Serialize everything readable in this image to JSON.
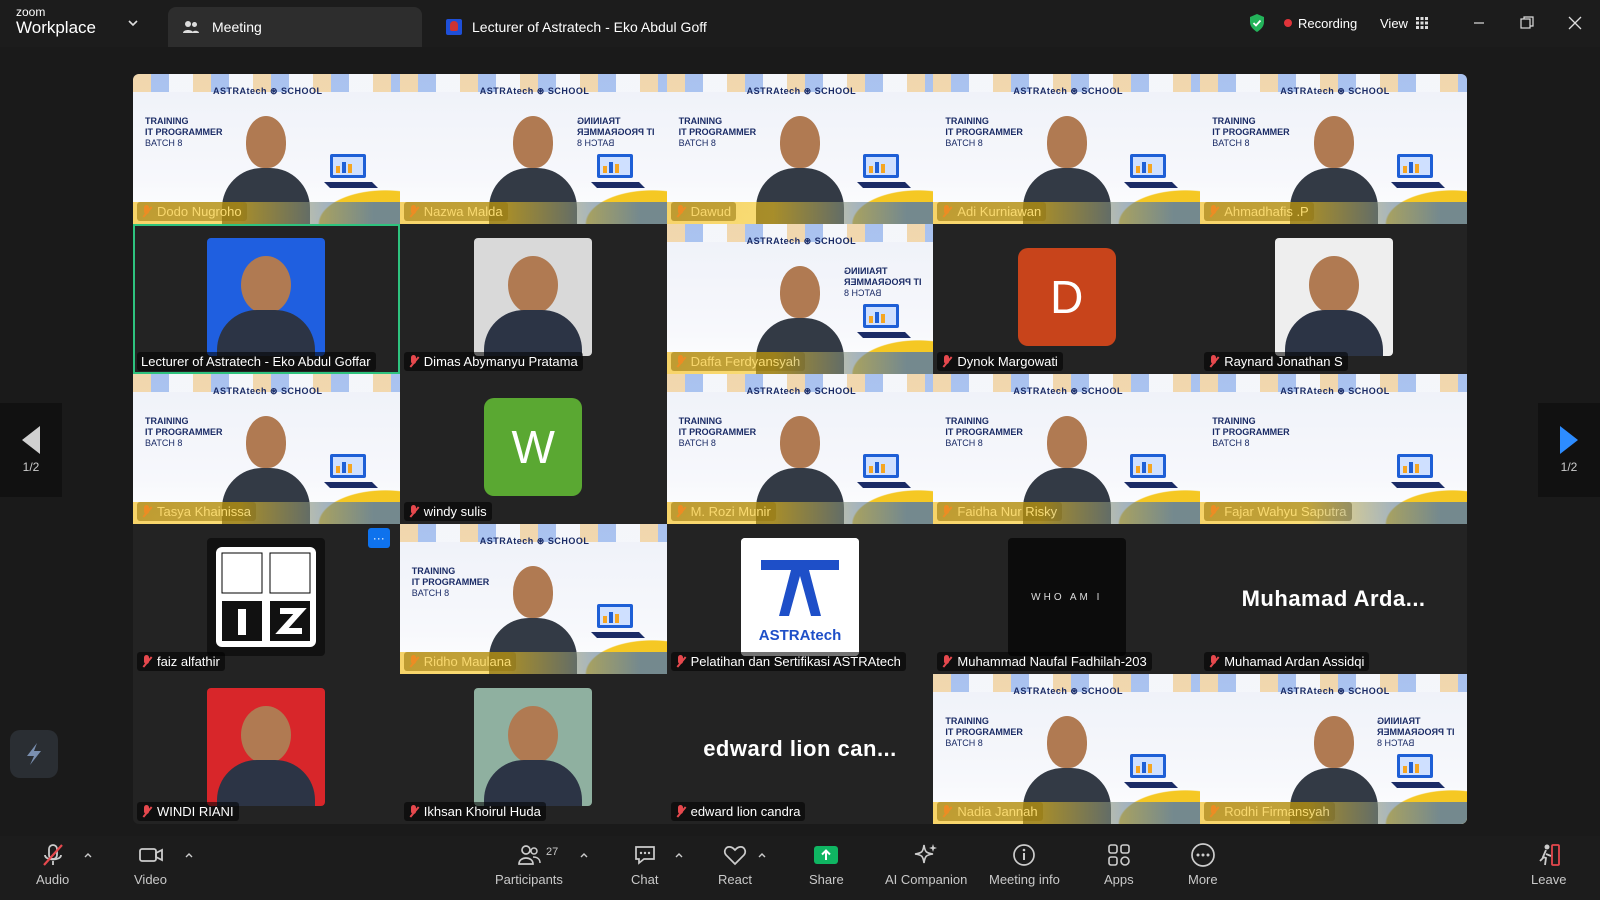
{
  "app": {
    "brand_line1": "zoom",
    "brand_line2": "Workplace"
  },
  "tabs": [
    {
      "label": "Meeting"
    },
    {
      "label": "Lecturer of Astratech - Eko Abdul Goff"
    }
  ],
  "topbar": {
    "recording_label": "Recording",
    "view_label": "View"
  },
  "banner": {
    "logo_text": "ASTRAtech  ⊛ SCHOOL",
    "title_line1": "TRAINING",
    "title_line2": "IT PROGRAMMER",
    "title_line3": "BATCH 8"
  },
  "participants": [
    {
      "name": "Dodo Nugroho",
      "kind": "banner",
      "mirror": false
    },
    {
      "name": "Nazwa Malda",
      "kind": "banner",
      "mirror": true
    },
    {
      "name": "Dawud",
      "kind": "banner",
      "mirror": false
    },
    {
      "name": "Adi Kurniawan",
      "kind": "banner",
      "mirror": false
    },
    {
      "name": "Ahmadhafis .P",
      "kind": "banner",
      "mirror": false
    },
    {
      "name": "Lecturer of Astratech - Eko Abdul Goffar",
      "kind": "photo",
      "bg": "#1f5fe0",
      "active": true,
      "muted": false
    },
    {
      "name": "Dimas Abymanyu Pratama",
      "kind": "photo",
      "bg": "#d9d9d9"
    },
    {
      "name": "Daffa Ferdyansyah",
      "kind": "banner",
      "mirror": true
    },
    {
      "name": "Dynok Margowati",
      "kind": "letter",
      "letter": "D",
      "color": "#c8441b"
    },
    {
      "name": "Raynard Jonathan S",
      "kind": "photo",
      "bg": "#eeeeee"
    },
    {
      "name": "Tasya Khainissa",
      "kind": "banner",
      "mirror": false
    },
    {
      "name": "windy sulis",
      "kind": "letter",
      "letter": "W",
      "color": "#5aa832"
    },
    {
      "name": "M. Rozi Munir",
      "kind": "banner",
      "mirror": false
    },
    {
      "name": "Faidha Nur Risky",
      "kind": "banner",
      "mirror": false
    },
    {
      "name": "Fajar Wahyu Saputra",
      "kind": "banner",
      "mirror": false,
      "empty": true
    },
    {
      "name": "faiz alfathir",
      "kind": "photo",
      "bg": "#111111",
      "badge": "···"
    },
    {
      "name": "Ridho Maulana",
      "kind": "banner",
      "mirror": false
    },
    {
      "name": "Pelatihan dan Sertifikasi ASTRAtech",
      "kind": "photo",
      "bg": "#ffffff",
      "logo_text": "ASTRAtech"
    },
    {
      "name": "Muhammad Naufal Fadhilah-203",
      "kind": "photo",
      "bg": "#0c0c0c",
      "logo_text": "WHO AM I"
    },
    {
      "name": "Muhamad Ardan Assidqi",
      "kind": "text",
      "display": "Muhamad  Arda..."
    },
    {
      "name": "WINDI RIANI",
      "kind": "photo",
      "bg": "#d8262a"
    },
    {
      "name": "Ikhsan Khoirul Huda",
      "kind": "photo",
      "bg": "#8fb0a0"
    },
    {
      "name": "edward lion candra",
      "kind": "text",
      "display": "edward  lion  can..."
    },
    {
      "name": "Nadia Jannah",
      "kind": "banner",
      "mirror": false
    },
    {
      "name": "Rodhi Firmansyah",
      "kind": "banner",
      "mirror": true
    }
  ],
  "pager": {
    "left_label": "1/2",
    "right_label": "1/2"
  },
  "toolbar": {
    "audio": "Audio",
    "video": "Video",
    "participants": "Participants",
    "participant_count": "27",
    "chat": "Chat",
    "react": "React",
    "share": "Share",
    "ai_companion": "AI Companion",
    "meeting_info": "Meeting info",
    "apps": "Apps",
    "more": "More",
    "leave": "Leave"
  },
  "colors": {
    "accent": "#0e72ed",
    "share_green": "#0fb562",
    "muted_red": "#e5484d",
    "active_border": "#2ec27e"
  }
}
